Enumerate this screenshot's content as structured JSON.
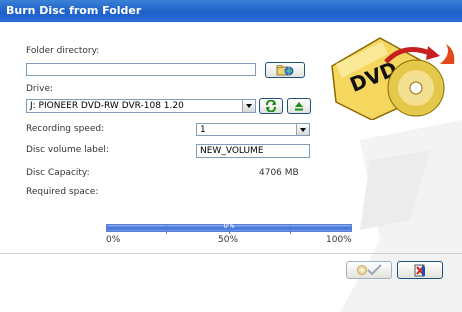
{
  "window": {
    "title": "Burn Disc from Folder"
  },
  "folder": {
    "label": "Folder directory:",
    "value": "",
    "browse_icon": "folder-globe-icon"
  },
  "drive": {
    "label": "Drive:",
    "selected": "J: PIONEER DVD-RW  DVR-108 1.20",
    "refresh_icon": "refresh-icon",
    "eject_icon": "eject-icon"
  },
  "speed": {
    "label": "Recording speed:",
    "selected": "1"
  },
  "volume": {
    "label": "Disc volume label:",
    "value": "NEW_VOLUME"
  },
  "capacity": {
    "label": "Disc Capacity:",
    "value": "4706 MB"
  },
  "required": {
    "label": "Required space:",
    "value": ""
  },
  "progress": {
    "value": 0,
    "text": "0%",
    "scale": [
      "0%",
      "50%",
      "100%"
    ]
  },
  "logo": {
    "text": "DVD"
  },
  "actions": {
    "burn_icon": "burn-check-icon",
    "cancel_icon": "exit-icon"
  },
  "colors": {
    "title_bar": "#2563d0",
    "progress": "#3f70d6",
    "accent_red": "#c72020"
  }
}
